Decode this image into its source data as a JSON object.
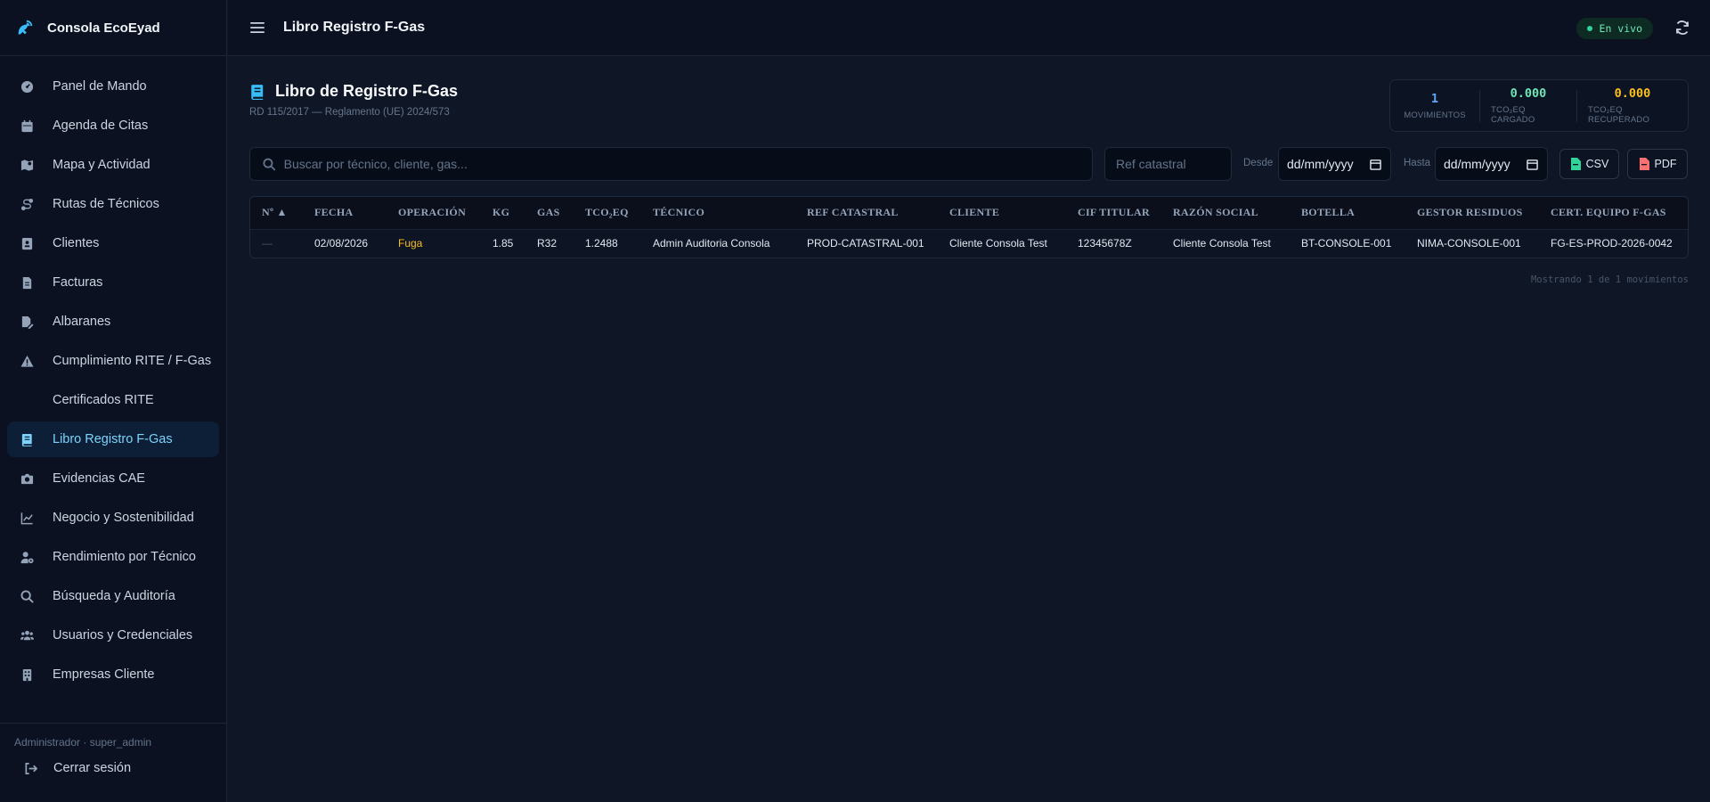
{
  "app": {
    "brand": "Consola EcoEyad",
    "header_title": "Libro Registro F-Gas",
    "live_label": "En vivo"
  },
  "sidebar": {
    "items": [
      {
        "label": "Panel de Mando",
        "icon": "dashboard-icon"
      },
      {
        "label": "Agenda de Citas",
        "icon": "calendar-icon"
      },
      {
        "label": "Mapa y Actividad",
        "icon": "map-icon"
      },
      {
        "label": "Rutas de Técnicos",
        "icon": "route-icon"
      },
      {
        "label": "Clientes",
        "icon": "contact-card-icon"
      },
      {
        "label": "Facturas",
        "icon": "invoice-icon"
      },
      {
        "label": "Albaranes",
        "icon": "delivery-note-icon"
      },
      {
        "label": "Cumplimiento RITE / F-Gas",
        "icon": "warning-icon"
      },
      {
        "label": "Certificados RITE",
        "icon": ""
      },
      {
        "label": "Libro Registro F-Gas",
        "icon": "book-icon",
        "active": true
      },
      {
        "label": "Evidencias CAE",
        "icon": "camera-icon"
      },
      {
        "label": "Negocio y Sostenibilidad",
        "icon": "chart-line-icon"
      },
      {
        "label": "Rendimiento por Técnico",
        "icon": "user-gear-icon"
      },
      {
        "label": "Búsqueda y Auditoría",
        "icon": "search-icon"
      },
      {
        "label": "Usuarios y Credenciales",
        "icon": "users-icon"
      },
      {
        "label": "Empresas Cliente",
        "icon": "building-icon"
      }
    ],
    "footer_user": "Administrador · super_admin",
    "logout_label": "Cerrar sesión"
  },
  "page": {
    "title": "Libro de Registro F-Gas",
    "subtitle": "RD 115/2017 — Reglamento (UE) 2024/573"
  },
  "stats": [
    {
      "value": "1",
      "label": "MOVIMIENTOS",
      "color": "#60a5fa"
    },
    {
      "value": "0.000",
      "label": "TCO₂EQ CARGADO",
      "color": "#6ee7b7"
    },
    {
      "value": "0.000",
      "label": "TCO₂EQ RECUPERADO",
      "color": "#fbbf24"
    }
  ],
  "filters": {
    "search_placeholder": "Buscar por técnico, cliente, gas...",
    "ref_placeholder": "Ref catastral",
    "desde_label": "Desde",
    "hasta_label": "Hasta",
    "date_placeholder": "dd/mm/yyyy",
    "csv_label": "CSV",
    "pdf_label": "PDF"
  },
  "table": {
    "columns": [
      "Nº ▲",
      "FECHA",
      "OPERACIÓN",
      "KG",
      "GAS",
      "TCO₂EQ",
      "TÉCNICO",
      "REF CATASTRAL",
      "CLIENTE",
      "CIF TITULAR",
      "RAZÓN SOCIAL",
      "BOTELLA",
      "GESTOR RESIDUOS",
      "CERT. EQUIPO F-GAS"
    ],
    "rows": [
      [
        "—",
        "02/08/2026",
        "Fuga",
        "1.85",
        "R32",
        "1.2488",
        "Admin Auditoria Consola",
        "PROD-CATASTRAL-001",
        "Cliente Consola Test",
        "12345678Z",
        "Cliente Consola Test",
        "BT-CONSOLE-001",
        "NIMA-CONSOLE-001",
        "FG-ES-PROD-2026-0042"
      ]
    ],
    "footer": "Mostrando 1 de 1 movimientos"
  }
}
